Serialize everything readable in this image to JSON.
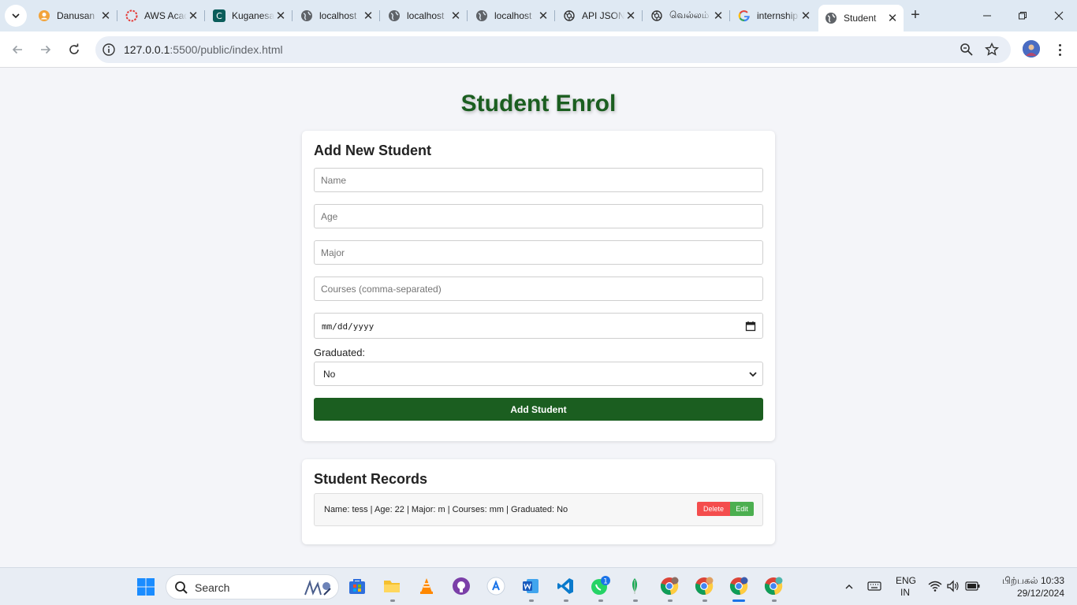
{
  "browser": {
    "tabs": [
      {
        "title": "Danusan",
        "favicon": "user-icon",
        "active": false
      },
      {
        "title": "AWS Academy",
        "favicon": "aws-icon",
        "active": false
      },
      {
        "title": "Kuganesan",
        "favicon": "c-icon",
        "active": false
      },
      {
        "title": "localhost",
        "favicon": "globe-icon",
        "active": false
      },
      {
        "title": "localhost",
        "favicon": "globe-icon",
        "active": false
      },
      {
        "title": "localhost",
        "favicon": "globe-icon",
        "active": false
      },
      {
        "title": "API JSON",
        "favicon": "openai-icon",
        "active": false
      },
      {
        "title": "வெல்லம்",
        "favicon": "openai-icon",
        "active": false
      },
      {
        "title": "internship",
        "favicon": "google-icon",
        "active": false
      },
      {
        "title": "Student",
        "favicon": "globe-icon",
        "active": true
      }
    ],
    "url_host": "127.0.0.1",
    "url_rest": ":5500/public/index.html"
  },
  "page": {
    "title": "Student Enrol",
    "form": {
      "heading": "Add New Student",
      "name_placeholder": "Name",
      "age_placeholder": "Age",
      "major_placeholder": "Major",
      "courses_placeholder": "Courses (comma-separated)",
      "date_placeholder": "mm/dd/yyyy",
      "graduated_label": "Graduated:",
      "graduated_value": "No",
      "submit_label": "Add Student"
    },
    "records": {
      "heading": "Student Records",
      "items": [
        {
          "text": "Name: tess | Age: 22 | Major: m | Courses: mm | Graduated: No",
          "delete_label": "Delete",
          "edit_label": "Edit"
        }
      ]
    }
  },
  "taskbar": {
    "search_label": "Search",
    "lang_top": "ENG",
    "lang_bottom": "IN",
    "time": "பிற்பகல் 10:33",
    "date": "29/12/2024",
    "whatsapp_badge": "1"
  },
  "colors": {
    "accent_green": "#1b5e20",
    "delete_red": "#f44d4d",
    "edit_green": "#4caf50"
  }
}
